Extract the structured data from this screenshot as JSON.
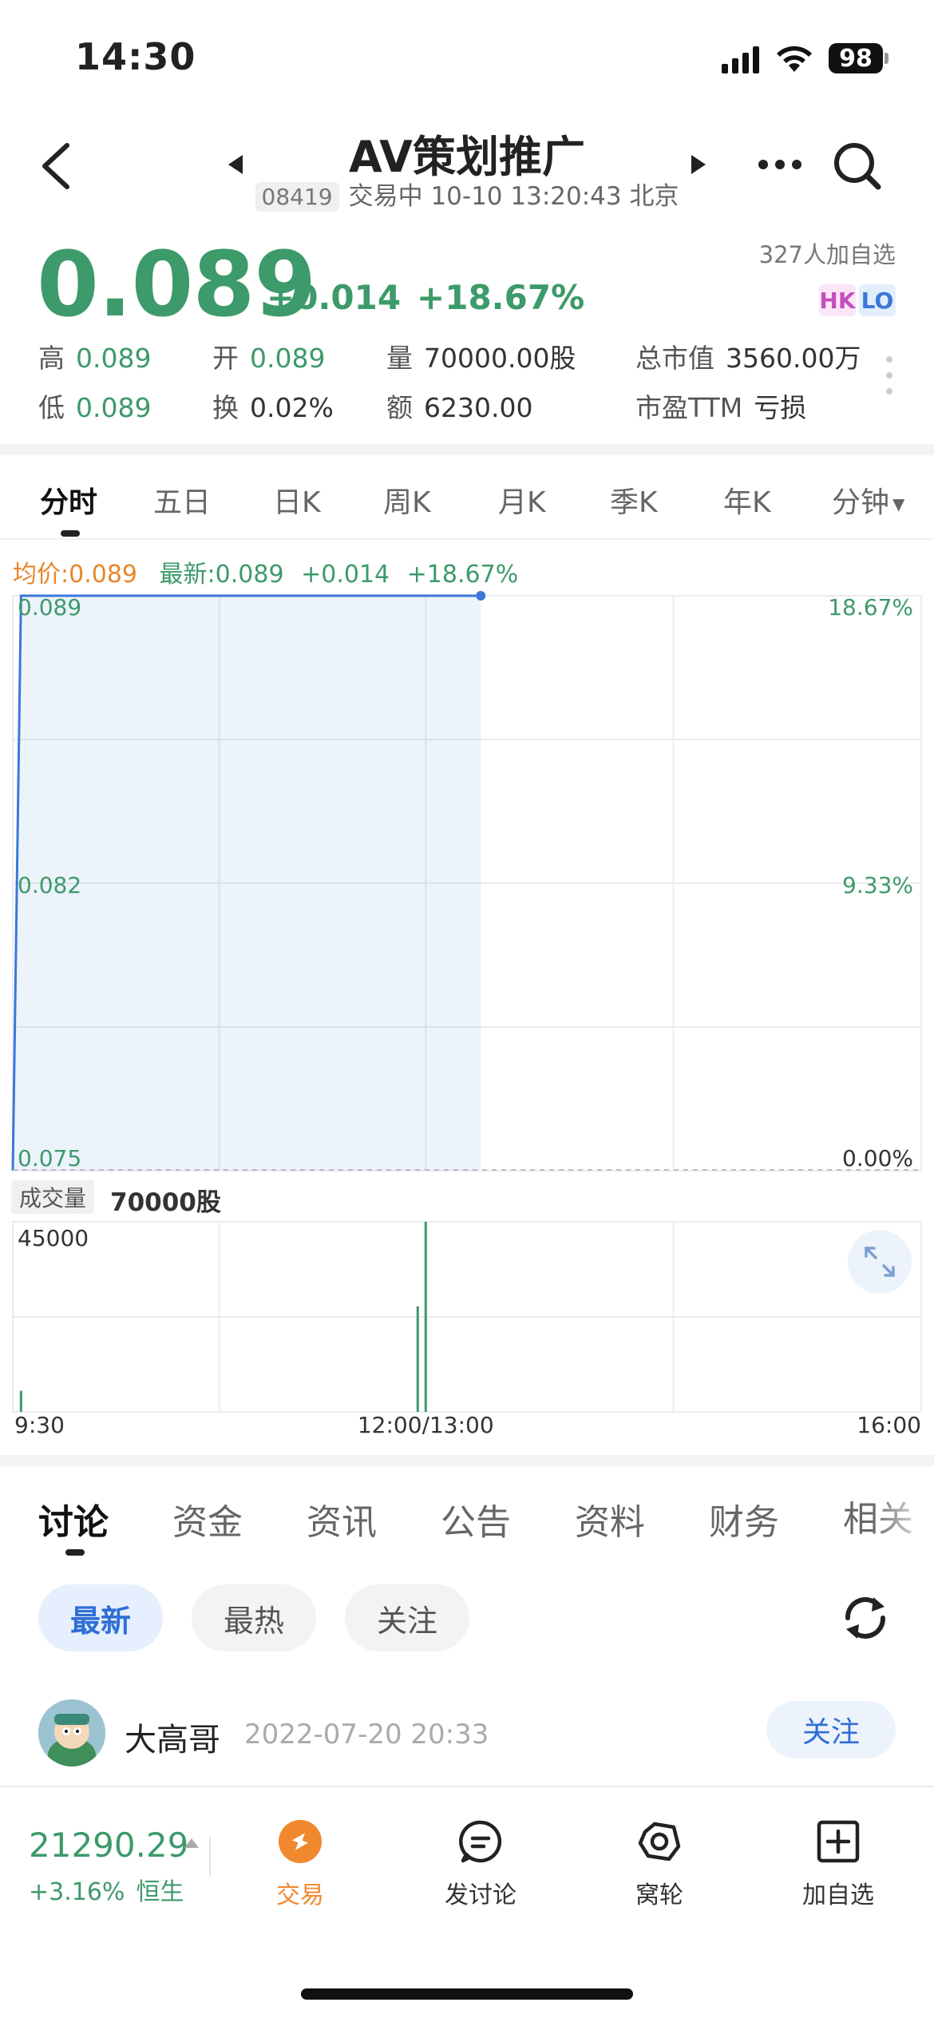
{
  "status_bar": {
    "time": "14:30",
    "battery": "98"
  },
  "header": {
    "title": "AV策划推广",
    "code": "08419",
    "status_line": "交易中 10-10 13:20:43 北京"
  },
  "quote": {
    "price": "0.089",
    "change": "+0.014",
    "change_pct": "+18.67%",
    "followers": "327人加自选",
    "tags": [
      "HK",
      "LO"
    ],
    "stats": [
      {
        "label": "高",
        "value": "0.089"
      },
      {
        "label": "开",
        "value": "0.089"
      },
      {
        "label": "量",
        "value": "70000.00股"
      },
      {
        "label": "总市值",
        "value": "3560.00万"
      },
      {
        "label": "低",
        "value": "0.089"
      },
      {
        "label": "换",
        "value": "0.02%"
      },
      {
        "label": "额",
        "value": "6230.00"
      },
      {
        "label": "市盈TTM",
        "value": "亏损"
      }
    ]
  },
  "chart_tabs": [
    "分时",
    "五日",
    "日K",
    "周K",
    "月K",
    "季K",
    "年K",
    "分钟"
  ],
  "legend": {
    "avg": "均价:0.089",
    "latest": "最新:0.089",
    "change": "+0.014",
    "change_pct": "+18.67%"
  },
  "chart_data": [
    {
      "type": "area",
      "y_left_ticks": [
        "0.089",
        "0.082",
        "0.075"
      ],
      "y_right_ticks": [
        "18.67%",
        "9.33%",
        "0.00%"
      ],
      "x_ticks": [
        "9:30",
        "12:00/13:00",
        "16:00"
      ],
      "ylim": [
        0.075,
        0.089
      ],
      "grid": true,
      "x": [
        "9:30",
        "9:33",
        "13:20"
      ],
      "values": [
        0.075,
        0.089,
        0.089
      ]
    },
    {
      "type": "bar",
      "volume_label": "成交量",
      "volume_total": "70000股",
      "y_max_tick": "45000",
      "ylim": [
        0,
        45000
      ],
      "x": [
        "9:33",
        "12:00",
        "13:00"
      ],
      "values": [
        5000,
        25000,
        45000
      ]
    }
  ],
  "discussion_tabs": [
    "讨论",
    "资金",
    "资讯",
    "公告",
    "资料",
    "财务",
    "相关"
  ],
  "filters": [
    "最新",
    "最热",
    "关注"
  ],
  "post": {
    "author": "大高哥",
    "time": "2022-07-20 20:33",
    "follow_label": "关注"
  },
  "footer": {
    "index_value": "21290.29",
    "index_change": "+3.16%",
    "index_name": "恒生",
    "nav": [
      {
        "label": "交易",
        "icon": "trade-icon"
      },
      {
        "label": "发讨论",
        "icon": "discuss-icon"
      },
      {
        "label": "窝轮",
        "icon": "warrant-icon"
      },
      {
        "label": "加自选",
        "icon": "add-watchlist-icon"
      }
    ]
  },
  "colors": {
    "up": "#3d9a6a",
    "avg": "#e8862a",
    "line": "#3b78d8",
    "accent": "#2f6fd6"
  }
}
